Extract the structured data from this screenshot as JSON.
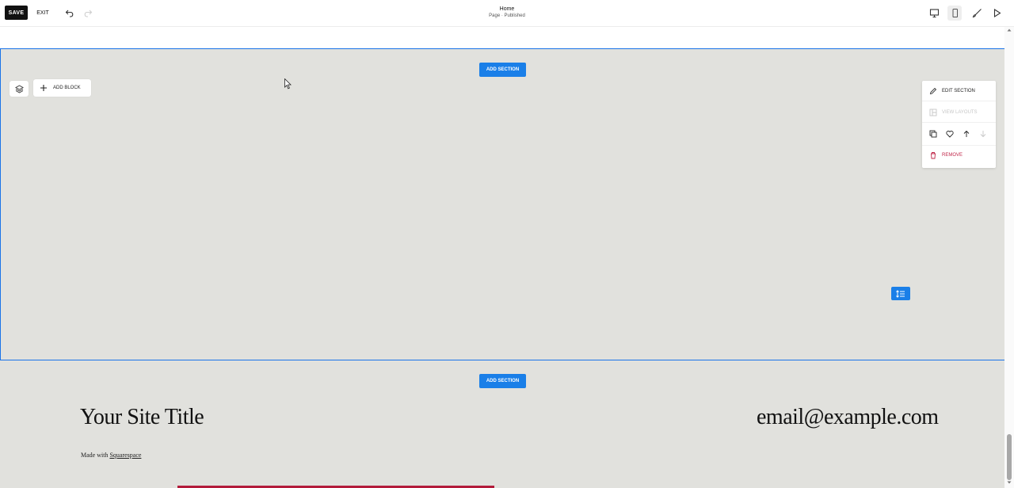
{
  "toolbar": {
    "save_label": "SAVE",
    "exit_label": "EXIT",
    "undo_icon": "undo-icon",
    "redo_icon": "redo-icon",
    "page_title": "Home",
    "page_status": "Page · Published",
    "device_icons": [
      "desktop-icon",
      "mobile-icon"
    ],
    "design_icon": "paintbrush-icon",
    "preview_icon": "play-icon"
  },
  "section": {
    "add_section_label": "ADD SECTION",
    "add_block_label": "ADD BLOCK",
    "layers_icon": "layers-icon",
    "menu": {
      "edit_section": "EDIT SECTION",
      "view_layouts": "VIEW LAYOUTS",
      "remove": "REMOVE",
      "icons": [
        "duplicate-icon",
        "heart-icon",
        "arrow-up-icon",
        "arrow-down-icon"
      ]
    },
    "handle_icon": "spacing-icon"
  },
  "footer": {
    "add_section_label": "ADD SECTION",
    "site_title": "Your Site Title",
    "email": "email@example.com",
    "made_with_prefix": "Made with ",
    "made_with_link": "Squarespace"
  },
  "colors": {
    "accent": "#1a7fe8",
    "section_bg": "#e1e1dd",
    "remove_red": "#c0274a",
    "disabled": "#c6c6c6"
  }
}
